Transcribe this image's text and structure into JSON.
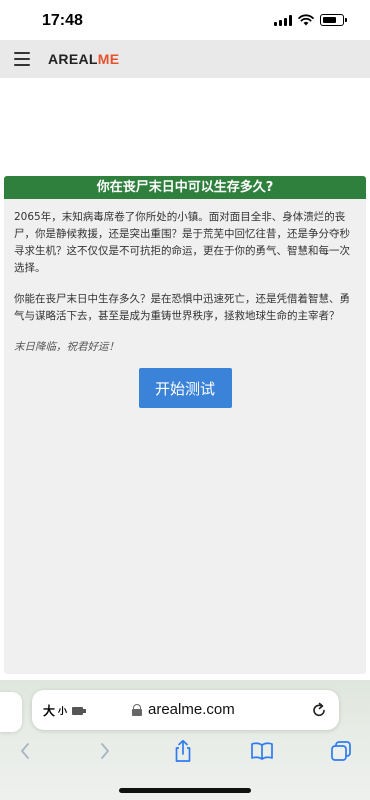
{
  "status_bar": {
    "time": "17:48"
  },
  "header": {
    "logo_part1": "AREAL",
    "logo_part2": "ME",
    "menu_icon": "hamburger-menu-icon"
  },
  "quiz": {
    "title": "你在丧尸末日中可以生存多久?",
    "intro": "2065年，末知病毒席卷了你所处的小镇。面对面目全非、身体溃烂的丧尸，你是静候救援，还是突出重围？是于荒芜中回忆往昔，还是争分夺秒寻求生机？这不仅仅是不可抗拒的命运，更在于你的勇气、智慧和每一次选择。",
    "question": "你能在丧尸末日中生存多久？是在恐惧中迅速死亡，还是凭借着智慧、勇气与谋略活下去，甚至是成为重铸世界秩序，拯救地球生命的主宰者？",
    "wish": "末日降临，祝君好运！",
    "start_label": "开始测试"
  },
  "browser": {
    "text_size_label": "大",
    "text_size_small": "小",
    "url": "arealme.com",
    "icons": [
      "back-icon",
      "forward-icon",
      "share-icon",
      "bookmarks-icon",
      "tabs-icon",
      "reload-icon",
      "lock-icon",
      "extension-icon"
    ]
  },
  "colors": {
    "title_bar": "#2f7f3d",
    "start_button": "#3b83d8",
    "logo_accent": "#e5532d",
    "card_background": "#f0f0f0"
  }
}
